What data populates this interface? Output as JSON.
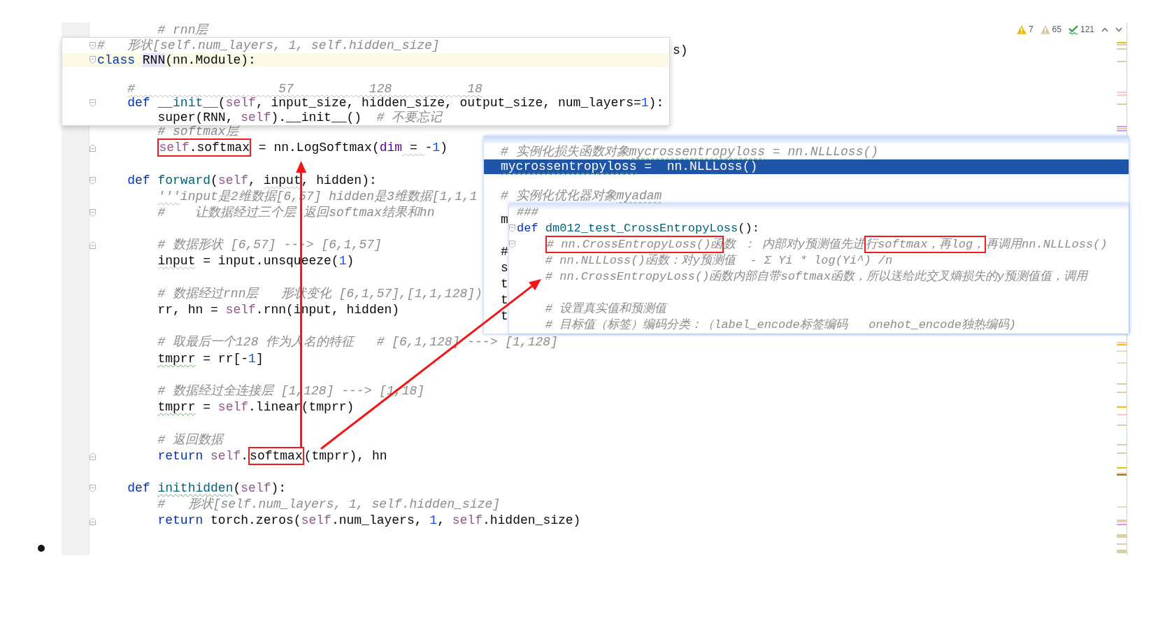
{
  "editor": {
    "lines_above_popup": [
      {
        "kind": "code",
        "tokens": [
          {
            "kind": "comment",
            "text": "        # rnn层"
          }
        ]
      }
    ],
    "hidden_tail": "s)",
    "lines": [
      {
        "kind": "code",
        "tokens": [
          {
            "kind": "comment",
            "text": "        # softmax层"
          }
        ]
      },
      {
        "kind": "code",
        "fold_end": true,
        "segments": [
          {
            "boxed": true,
            "tokens": [
              {
                "kind": "self",
                "text": "        self"
              },
              {
                "kind": "plain",
                "text": ".softmax"
              }
            ]
          },
          {
            "boxed": false,
            "tokens": [
              {
                "kind": "plain",
                "text": " = nn.LogSoftmax("
              },
              {
                "kind": "arg",
                "text": "dim"
              },
              {
                "kind": "plain",
                "text": " = ",
                "warning": true
              },
              {
                "kind": "plain",
                "text": "-"
              },
              {
                "kind": "num",
                "text": "1"
              },
              {
                "kind": "plain",
                "text": ")"
              }
            ]
          }
        ]
      },
      {
        "kind": "blank"
      },
      {
        "kind": "code",
        "fold_start": true,
        "tokens": [
          {
            "kind": "kw",
            "text": "    def "
          },
          {
            "kind": "fn",
            "text": "forward"
          },
          {
            "kind": "plain",
            "text": "("
          },
          {
            "kind": "self",
            "text": "self"
          },
          {
            "kind": "plain",
            "text": ", "
          },
          {
            "kind": "plain",
            "text": "input",
            "warning": true
          },
          {
            "kind": "plain",
            "text": ", hidden):"
          }
        ]
      },
      {
        "kind": "code",
        "tokens": [
          {
            "kind": "comment",
            "text": "        '''",
            "warning": true
          },
          {
            "kind": "comment",
            "text": "input是2维数据[6,57] hidden是3维数据[1,1,1"
          }
        ]
      },
      {
        "kind": "code",
        "fold_start": true,
        "tokens": [
          {
            "kind": "comment",
            "text": "        #    让数据经过三个层 返回softmax结果和hn"
          }
        ]
      },
      {
        "kind": "blank"
      },
      {
        "kind": "code",
        "fold_end": true,
        "tokens": [
          {
            "kind": "comment",
            "text": "        # 数据形状 [6,57] ---> [6,1,57]"
          }
        ]
      },
      {
        "kind": "code",
        "tokens": [
          {
            "kind": "plain",
            "text": "        input",
            "warning": true
          },
          {
            "kind": "plain",
            "text": " = input.unsqueeze("
          },
          {
            "kind": "num",
            "text": "1"
          },
          {
            "kind": "plain",
            "text": ")"
          }
        ]
      },
      {
        "kind": "blank"
      },
      {
        "kind": "code",
        "tokens": [
          {
            "kind": "comment",
            "text": "        # 数据经过rnn层   形状变化 [6,1,57],[1,1,128])"
          }
        ]
      },
      {
        "kind": "code",
        "tokens": [
          {
            "kind": "plain",
            "text": "        rr, hn = "
          },
          {
            "kind": "self",
            "text": "self"
          },
          {
            "kind": "plain",
            "text": ".rnn(input, hidden)"
          }
        ]
      },
      {
        "kind": "blank"
      },
      {
        "kind": "code",
        "tokens": [
          {
            "kind": "comment",
            "text": "        # 取最后一个128 作为人名的特征   # [6,1,128] ---> [1,128]"
          }
        ]
      },
      {
        "kind": "code",
        "tokens": [
          {
            "kind": "plain",
            "text": "        tmprr",
            "typo": true
          },
          {
            "kind": "plain",
            "text": " = rr[-"
          },
          {
            "kind": "num",
            "text": "1"
          },
          {
            "kind": "plain",
            "text": "]"
          }
        ]
      },
      {
        "kind": "blank"
      },
      {
        "kind": "code",
        "tokens": [
          {
            "kind": "comment",
            "text": "        # 数据经过全连接层 [1,128] ---> [1,18]"
          }
        ]
      },
      {
        "kind": "code",
        "tokens": [
          {
            "kind": "plain",
            "text": "        tmprr",
            "typo": true
          },
          {
            "kind": "plain",
            "text": " = "
          },
          {
            "kind": "self",
            "text": "self"
          },
          {
            "kind": "plain",
            "text": ".linear(tmprr)"
          }
        ]
      },
      {
        "kind": "blank"
      },
      {
        "kind": "code",
        "tokens": [
          {
            "kind": "comment",
            "text": "        # 返回数据"
          }
        ]
      },
      {
        "kind": "code",
        "fold_end": true,
        "segments": [
          {
            "boxed": false,
            "tokens": [
              {
                "kind": "kw",
                "text": "        return "
              },
              {
                "kind": "self",
                "text": "self"
              },
              {
                "kind": "plain",
                "text": "."
              }
            ]
          },
          {
            "boxed": true,
            "tokens": [
              {
                "kind": "plain",
                "text": "softmax"
              }
            ]
          },
          {
            "boxed": false,
            "tokens": [
              {
                "kind": "plain",
                "text": "(tmprr), hn"
              }
            ]
          }
        ]
      },
      {
        "kind": "blank"
      },
      {
        "kind": "code",
        "fold_start": true,
        "tokens": [
          {
            "kind": "kw",
            "text": "    def "
          },
          {
            "kind": "fn",
            "text": "inithidden",
            "typo": true
          },
          {
            "kind": "plain",
            "text": "("
          },
          {
            "kind": "self",
            "text": "self"
          },
          {
            "kind": "plain",
            "text": "):"
          }
        ]
      },
      {
        "kind": "code",
        "tokens": [
          {
            "kind": "comment",
            "text": "        #   形状[self.num_layers, 1, self.hidden_size]"
          }
        ]
      },
      {
        "kind": "code",
        "fold_end": true,
        "tokens": [
          {
            "kind": "kw",
            "text": "        return "
          },
          {
            "kind": "plain",
            "text": "torch.zeros("
          },
          {
            "kind": "self",
            "text": "self"
          },
          {
            "kind": "plain",
            "text": ".num_layers, "
          },
          {
            "kind": "num",
            "text": "1"
          },
          {
            "kind": "plain",
            "text": ", "
          },
          {
            "kind": "self",
            "text": "self"
          },
          {
            "kind": "plain",
            "text": ".hidden_size)"
          }
        ]
      }
    ]
  },
  "inspections": [
    {
      "kind": "warning",
      "count": "7"
    },
    {
      "kind": "weak_warning",
      "count": "65"
    },
    {
      "kind": "typo",
      "count": "121"
    }
  ],
  "usages_popup": {
    "lines": [
      {
        "kind": "code",
        "fold_start": true,
        "tokens": [
          {
            "kind": "comment",
            "text": "#   形状[self.num_layers, 1, self.hidden_size]"
          }
        ]
      },
      {
        "kind": "caret",
        "fold_start": true,
        "tokens": [
          {
            "kind": "kw",
            "text": "class "
          },
          {
            "kind": "plain",
            "text": "RNN",
            "highlight": true
          },
          {
            "kind": "plain",
            "text": "(nn.Module):"
          }
        ]
      },
      {
        "kind": "blank"
      },
      {
        "kind": "code",
        "tokens": [
          {
            "kind": "comment",
            "text": "    #                   57          128          18",
            "warning": true
          }
        ]
      },
      {
        "kind": "code",
        "fold_start": true,
        "tokens": [
          {
            "kind": "kw",
            "text": "    def "
          },
          {
            "kind": "fn",
            "text": "__init__"
          },
          {
            "kind": "plain",
            "text": "("
          },
          {
            "kind": "self",
            "text": "self"
          },
          {
            "kind": "plain",
            "text": ", input_size, hidden_size, output_size, num_layers="
          },
          {
            "kind": "num",
            "text": "1"
          },
          {
            "kind": "plain",
            "text": "):"
          }
        ]
      },
      {
        "kind": "code",
        "tokens": [
          {
            "kind": "plain",
            "text": "        super(RNN, "
          },
          {
            "kind": "self",
            "text": "self"
          },
          {
            "kind": "plain",
            "text": ").__init__()  "
          },
          {
            "kind": "comment",
            "text": "# 不要忘记"
          }
        ]
      }
    ]
  },
  "definition_popup": {
    "lines": [
      {
        "kind": "code",
        "tokens": [
          {
            "kind": "comment",
            "text": "# 实例化损失函数对象"
          },
          {
            "kind": "comment",
            "text": "mycrossentropyloss",
            "typo": true
          },
          {
            "kind": "comment",
            "text": " = nn.NLLLoss()"
          }
        ]
      },
      {
        "kind": "selected",
        "tokens": [
          {
            "kind": "plain",
            "text": "mycrossentropyloss",
            "typo": true
          },
          {
            "kind": "plain",
            "text": " =  nn.NLLLoss()"
          }
        ]
      },
      {
        "kind": "blank"
      },
      {
        "kind": "code",
        "tokens": [
          {
            "kind": "comment",
            "text": "# 实例化优化器对象"
          },
          {
            "kind": "comment",
            "text": "myadam",
            "typo": true
          }
        ]
      }
    ],
    "covered_lines": [
      {
        "kind": "code",
        "text": "m"
      },
      {
        "kind": "blank"
      },
      {
        "kind": "code",
        "text": "#"
      },
      {
        "kind": "code",
        "text": "s"
      },
      {
        "kind": "code",
        "text": "t"
      },
      {
        "kind": "code",
        "text": "t"
      },
      {
        "kind": "code",
        "text": "t"
      }
    ],
    "inner_popup": {
      "lines": [
        {
          "kind": "code",
          "tokens": [
            {
              "kind": "comment",
              "text": "###"
            }
          ]
        },
        {
          "kind": "code",
          "fold_start": true,
          "tokens": [
            {
              "kind": "kw",
              "text": "def "
            },
            {
              "kind": "fn",
              "text": "dm012_test_CrossEntropyLoss"
            },
            {
              "kind": "plain",
              "text": "():"
            }
          ]
        },
        {
          "kind": "code",
          "fold_start": true,
          "segments": [
            {
              "boxed": true,
              "tokens": [
                {
                  "kind": "comment",
                  "text": "    # nn.CrossEntropyLoss()函"
                }
              ]
            },
            {
              "boxed": false,
              "tokens": [
                {
                  "kind": "comment",
                  "text": "数 ： 内部对y预测值先进"
                }
              ]
            },
            {
              "boxed": true,
              "tokens": [
                {
                  "kind": "comment",
                  "text": "行softmax，再log，"
                }
              ]
            },
            {
              "boxed": false,
              "tokens": [
                {
                  "kind": "comment",
                  "text": "再调用nn.NLLLoss()"
                }
              ]
            }
          ]
        },
        {
          "kind": "code",
          "tokens": [
            {
              "kind": "comment",
              "text": "    # nn.NLLLoss()函数：对y预测值  - Σ Yi * log(Yi^) /n"
            }
          ]
        },
        {
          "kind": "code",
          "tokens": [
            {
              "kind": "comment",
              "text": "    # nn.CrossEntropyLoss()函数内部自带softmax函数，所以送给此交叉熵损失的y预测值值，调用"
            }
          ]
        },
        {
          "kind": "blank"
        },
        {
          "kind": "code",
          "tokens": [
            {
              "kind": "comment",
              "text": "    # 设置真实值和预测值"
            }
          ]
        },
        {
          "kind": "code",
          "tokens": [
            {
              "kind": "comment",
              "text": "    # 目标值（标签）编码分类：（label_encode标签编码   onehot_encode独热编码)"
            }
          ]
        }
      ]
    }
  }
}
